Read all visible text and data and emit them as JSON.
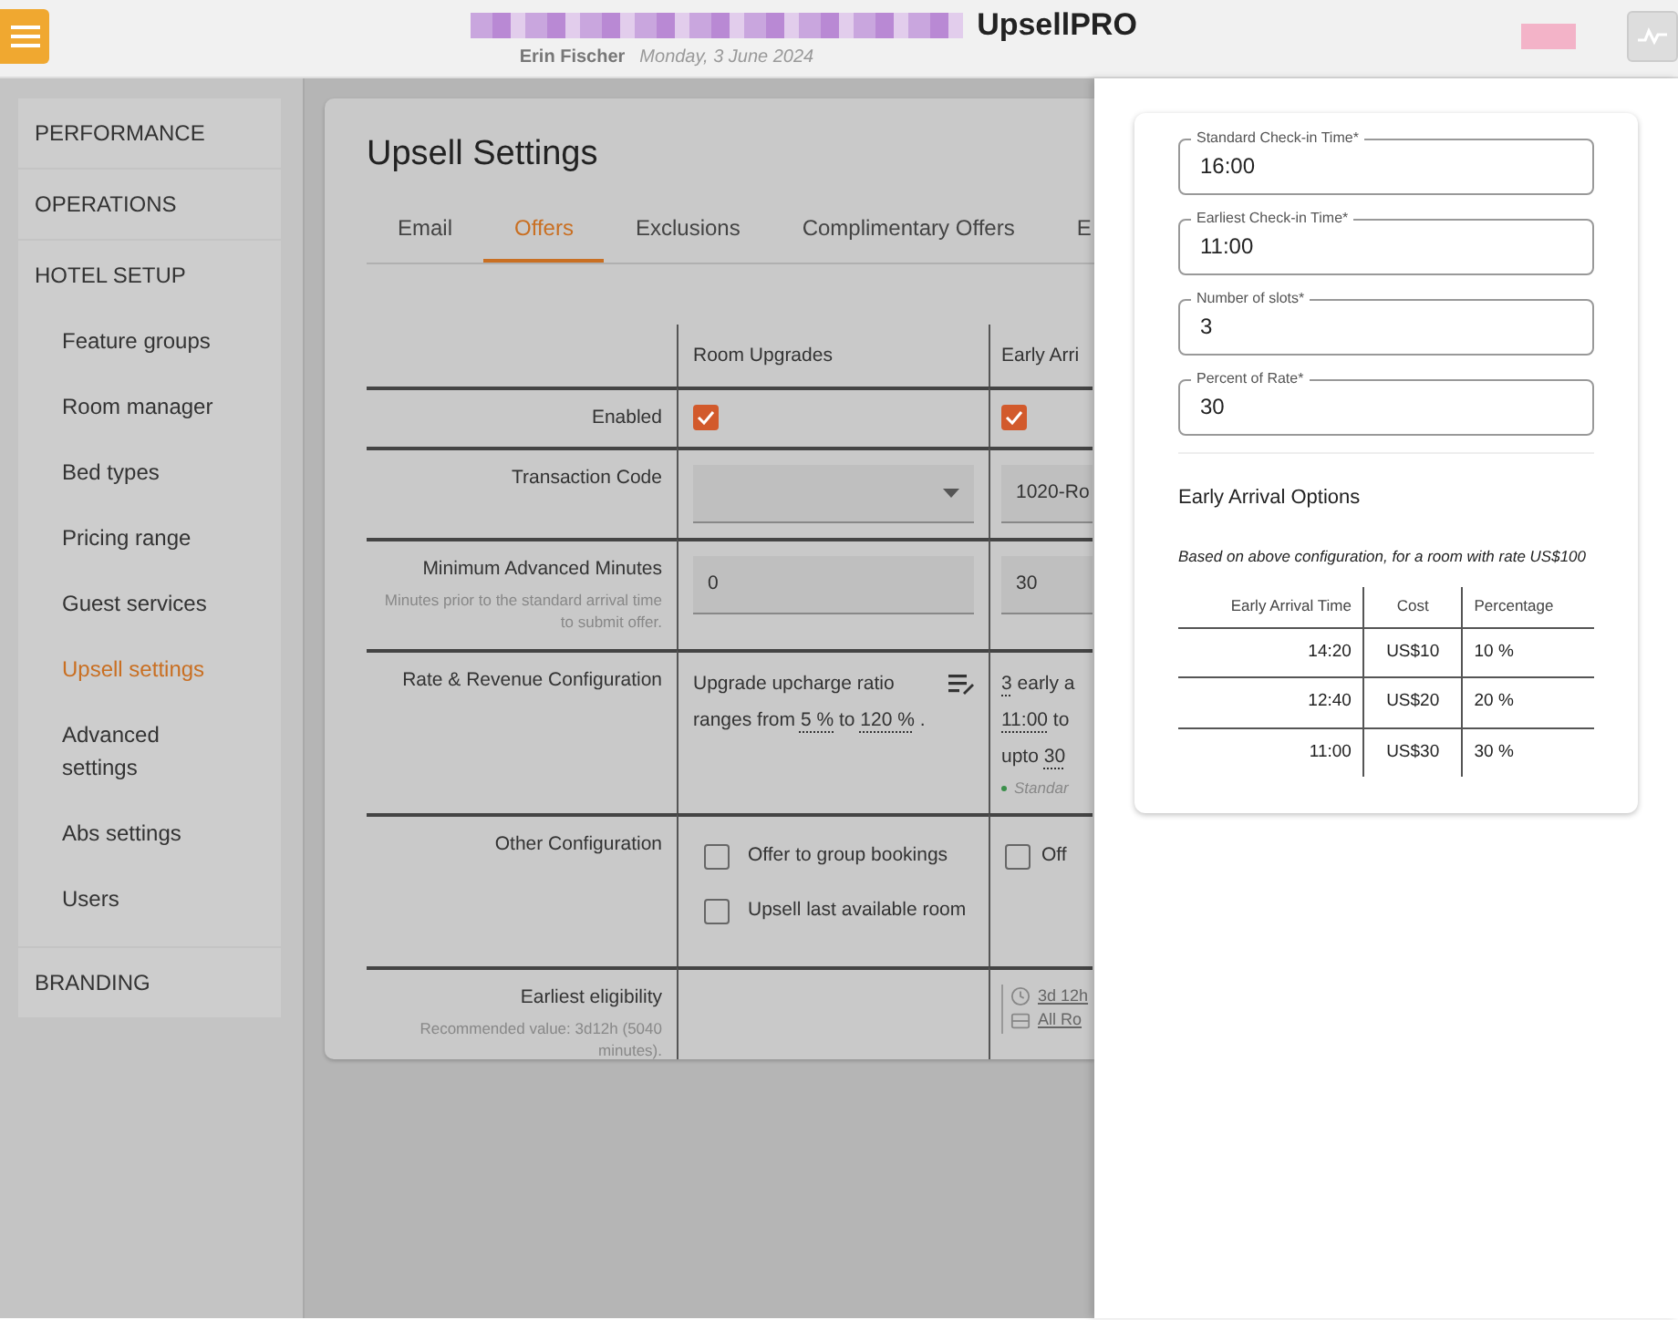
{
  "header": {
    "app_name": "UpsellPRO",
    "user": "Erin Fischer",
    "date": "Monday, 3 June 2024"
  },
  "sidebar": {
    "items": [
      {
        "label": "PERFORMANCE",
        "selected": false
      },
      {
        "label": "OPERATIONS",
        "selected": false
      },
      {
        "label": "HOTEL SETUP",
        "selected": false,
        "children": [
          {
            "label": "Feature groups",
            "selected": false
          },
          {
            "label": "Room manager",
            "selected": false
          },
          {
            "label": "Bed types",
            "selected": false
          },
          {
            "label": "Pricing range",
            "selected": false
          },
          {
            "label": "Guest services",
            "selected": false
          },
          {
            "label": "Upsell settings",
            "selected": true
          },
          {
            "label": "Advanced settings",
            "selected": false
          },
          {
            "label": "Abs settings",
            "selected": false
          },
          {
            "label": "Users",
            "selected": false
          }
        ]
      },
      {
        "label": "BRANDING",
        "selected": false
      }
    ]
  },
  "page": {
    "title": "Upsell Settings",
    "tabs": [
      {
        "label": "Email",
        "selected": false
      },
      {
        "label": "Offers",
        "selected": true
      },
      {
        "label": "Exclusions",
        "selected": false
      },
      {
        "label": "Complimentary Offers",
        "selected": false
      },
      {
        "label": "E",
        "selected": false
      }
    ],
    "table": {
      "columns": [
        "Room Upgrades",
        "Early Arri"
      ],
      "rows": [
        {
          "label": "Enabled",
          "cells": [
            {
              "kind": "checkbox",
              "checked": true
            },
            {
              "kind": "checkbox",
              "checked": true
            }
          ]
        },
        {
          "label": "Transaction Code",
          "cells": [
            {
              "kind": "select"
            },
            {
              "kind": "select",
              "value": "1020-Ro"
            }
          ]
        },
        {
          "label": "Minimum Advanced Minutes",
          "hint": "Minutes prior to the standard arrival time to submit offer.",
          "cells": [
            {
              "kind": "input",
              "value": "0"
            },
            {
              "kind": "input",
              "value": "30"
            }
          ]
        },
        {
          "label": "Rate & Revenue Configuration",
          "cells": [
            {
              "kind": "sentence",
              "edit_icon": true,
              "lines": [
                [
                  {
                    "kind": "text",
                    "text": "Upgrade upcharge ratio ranges from "
                  },
                  {
                    "kind": "value",
                    "text": "5 %"
                  },
                  {
                    "kind": "text",
                    "text": " to "
                  },
                  {
                    "kind": "value",
                    "text": "120 %"
                  },
                  {
                    "kind": "text",
                    "text": " ."
                  }
                ]
              ]
            },
            {
              "kind": "sentence",
              "lines": [
                [
                  {
                    "kind": "value",
                    "text": "3"
                  },
                  {
                    "kind": "text",
                    "text": " early a"
                  }
                ],
                [
                  {
                    "kind": "value",
                    "text": "11:00"
                  },
                  {
                    "kind": "text",
                    "text": " to"
                  }
                ],
                [
                  {
                    "kind": "text",
                    "text": "upto "
                  },
                  {
                    "kind": "value",
                    "text": "30"
                  }
                ]
              ],
              "note": "Standar"
            }
          ]
        },
        {
          "label": "Other Configuration",
          "cells": [
            {
              "kind": "checklist",
              "items": [
                {
                  "label": "Offer to group bookings",
                  "checked": false
                },
                {
                  "label": "Upsell last available room",
                  "checked": false
                }
              ]
            },
            {
              "kind": "checklist",
              "items": [
                {
                  "label": "Off",
                  "checked": false
                }
              ]
            }
          ]
        },
        {
          "label": "Earliest eligibility",
          "hint": "Recommended value: 3d12h (5040 minutes).",
          "cells": [
            {
              "kind": "empty"
            },
            {
              "kind": "links",
              "items": [
                {
                  "text": "3d 12h"
                },
                {
                  "text": "All Ro"
                }
              ]
            }
          ]
        }
      ]
    }
  },
  "drawer": {
    "fields": [
      {
        "label": "Standard Check-in Time*",
        "value": "16:00"
      },
      {
        "label": "Earliest Check-in Time*",
        "value": "11:00"
      },
      {
        "label": "Number of slots*",
        "value": "3"
      },
      {
        "label": "Percent of Rate*",
        "value": "30"
      }
    ],
    "options_title": "Early Arrival Options",
    "note": "Based on above configuration, for a room with rate US$100",
    "table": {
      "columns": [
        "Early Arrival Time",
        "Cost",
        "Percentage"
      ],
      "rows": [
        [
          "14:20",
          "US$10",
          "10 %"
        ],
        [
          "12:40",
          "US$20",
          "20 %"
        ],
        [
          "11:00",
          "US$30",
          "30 %"
        ]
      ]
    }
  }
}
